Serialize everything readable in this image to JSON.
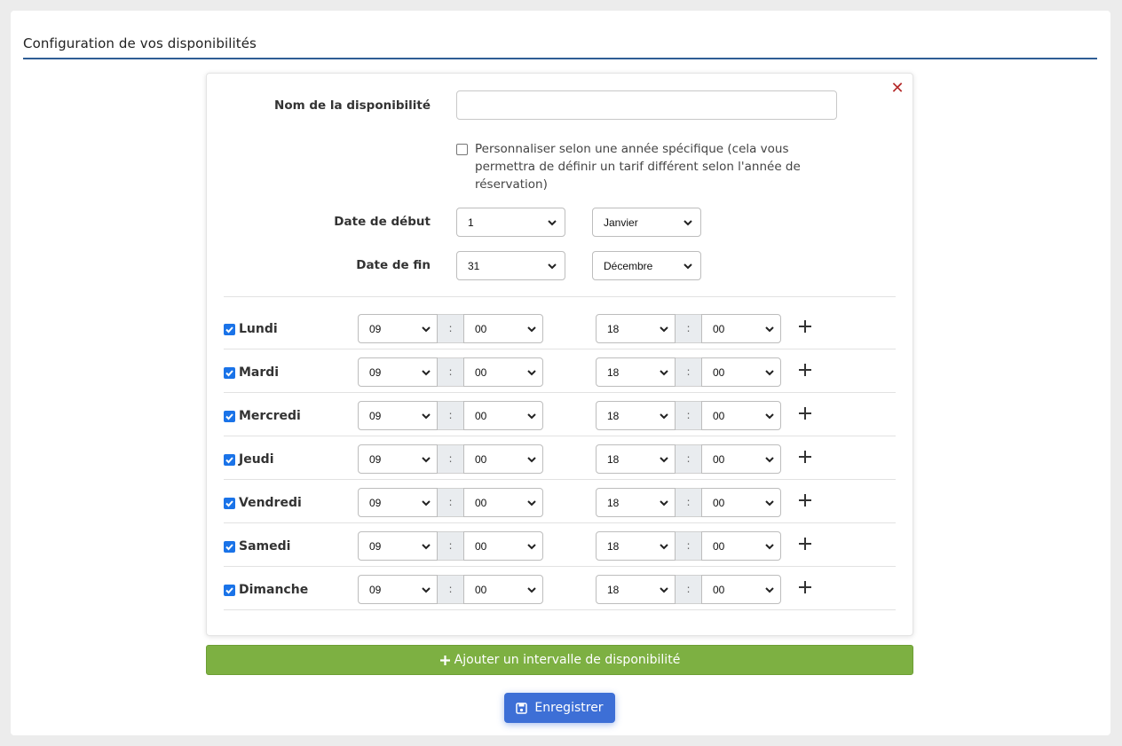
{
  "page": {
    "title": "Configuration de vos disponibilités"
  },
  "form": {
    "name_label": "Nom de la disponibilité",
    "name_value": "",
    "custom_year_label": "Personnaliser selon une année spécifique (cela vous permettra de définir un tarif différent selon l'année de réservation)",
    "custom_year_checked": false,
    "start_label": "Date de début",
    "start_day": "1",
    "start_month": "Janvier",
    "end_label": "Date de fin",
    "end_day": "31",
    "end_month": "Décembre"
  },
  "days": [
    {
      "label": "Lundi",
      "checked": true,
      "start_h": "09",
      "start_m": "00",
      "end_h": "18",
      "end_m": "00"
    },
    {
      "label": "Mardi",
      "checked": true,
      "start_h": "09",
      "start_m": "00",
      "end_h": "18",
      "end_m": "00"
    },
    {
      "label": "Mercredi",
      "checked": true,
      "start_h": "09",
      "start_m": "00",
      "end_h": "18",
      "end_m": "00"
    },
    {
      "label": "Jeudi",
      "checked": true,
      "start_h": "09",
      "start_m": "00",
      "end_h": "18",
      "end_m": "00"
    },
    {
      "label": "Vendredi",
      "checked": true,
      "start_h": "09",
      "start_m": "00",
      "end_h": "18",
      "end_m": "00"
    },
    {
      "label": "Samedi",
      "checked": true,
      "start_h": "09",
      "start_m": "00",
      "end_h": "18",
      "end_m": "00"
    },
    {
      "label": "Dimanche",
      "checked": true,
      "start_h": "09",
      "start_m": "00",
      "end_h": "18",
      "end_m": "00"
    }
  ],
  "time_separator": ":",
  "buttons": {
    "add_interval": "Ajouter un intervalle de disponibilité",
    "save": "Enregistrer",
    "close_glyph": "✕"
  },
  "icons": {
    "close": "close-icon",
    "chevron": "chevron-down-icon",
    "plus": "plus-icon",
    "save": "floppy-disk-icon",
    "check": "checkmark-icon"
  },
  "colors": {
    "accent_rule": "#2f5d95",
    "add_button": "#7db042",
    "save_button": "#3d6fd6",
    "close": "#b52b2b",
    "checkbox": "#1a73e8"
  }
}
